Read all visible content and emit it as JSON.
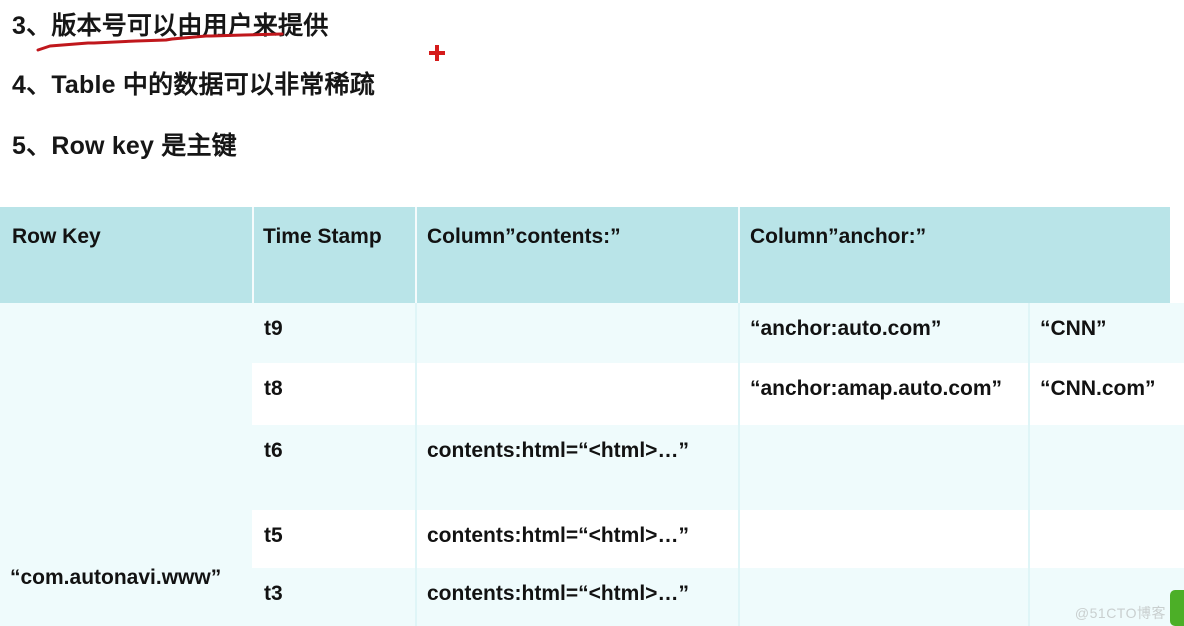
{
  "slide": {
    "bullets": [
      {
        "num": "3、",
        "text": "版本号可以由用户来提供",
        "underlined": true
      },
      {
        "num": "4、",
        "text": "Table 中的数据可以非常稀疏",
        "underlined": false
      },
      {
        "num": "5、",
        "text": "Row key 是主键",
        "underlined": false
      }
    ],
    "annotations": {
      "underline_color": "#c0171c",
      "plus_marker_color": "#d51b1b"
    }
  },
  "table": {
    "header_bg": "#b9e4e8",
    "row_tint_bg": "#effbfc",
    "columns": [
      "Row  Key",
      "Time Stamp",
      "Column”contents:”",
      "Column”anchor:”"
    ],
    "row_key": "“com.autonavi.www”",
    "rows": [
      {
        "time_stamp": "t9",
        "contents": "",
        "anchor_key": "“anchor:auto.com”",
        "anchor_value": "“CNN”"
      },
      {
        "time_stamp": "t8",
        "contents": "",
        "anchor_key": "“anchor:amap.auto.com”",
        "anchor_value": "“CNN.com”"
      },
      {
        "time_stamp": "t6",
        "contents": "contents:html=“<html>…”",
        "anchor_key": "",
        "anchor_value": ""
      },
      {
        "time_stamp": "t5",
        "contents": "contents:html=“<html>…”",
        "anchor_key": "",
        "anchor_value": ""
      },
      {
        "time_stamp": "t3",
        "contents": "contents:html=“<html>…”",
        "anchor_key": "",
        "anchor_value": ""
      }
    ]
  },
  "watermark": {
    "text": "@51CTO博客",
    "tab_color": "#4caf27"
  }
}
